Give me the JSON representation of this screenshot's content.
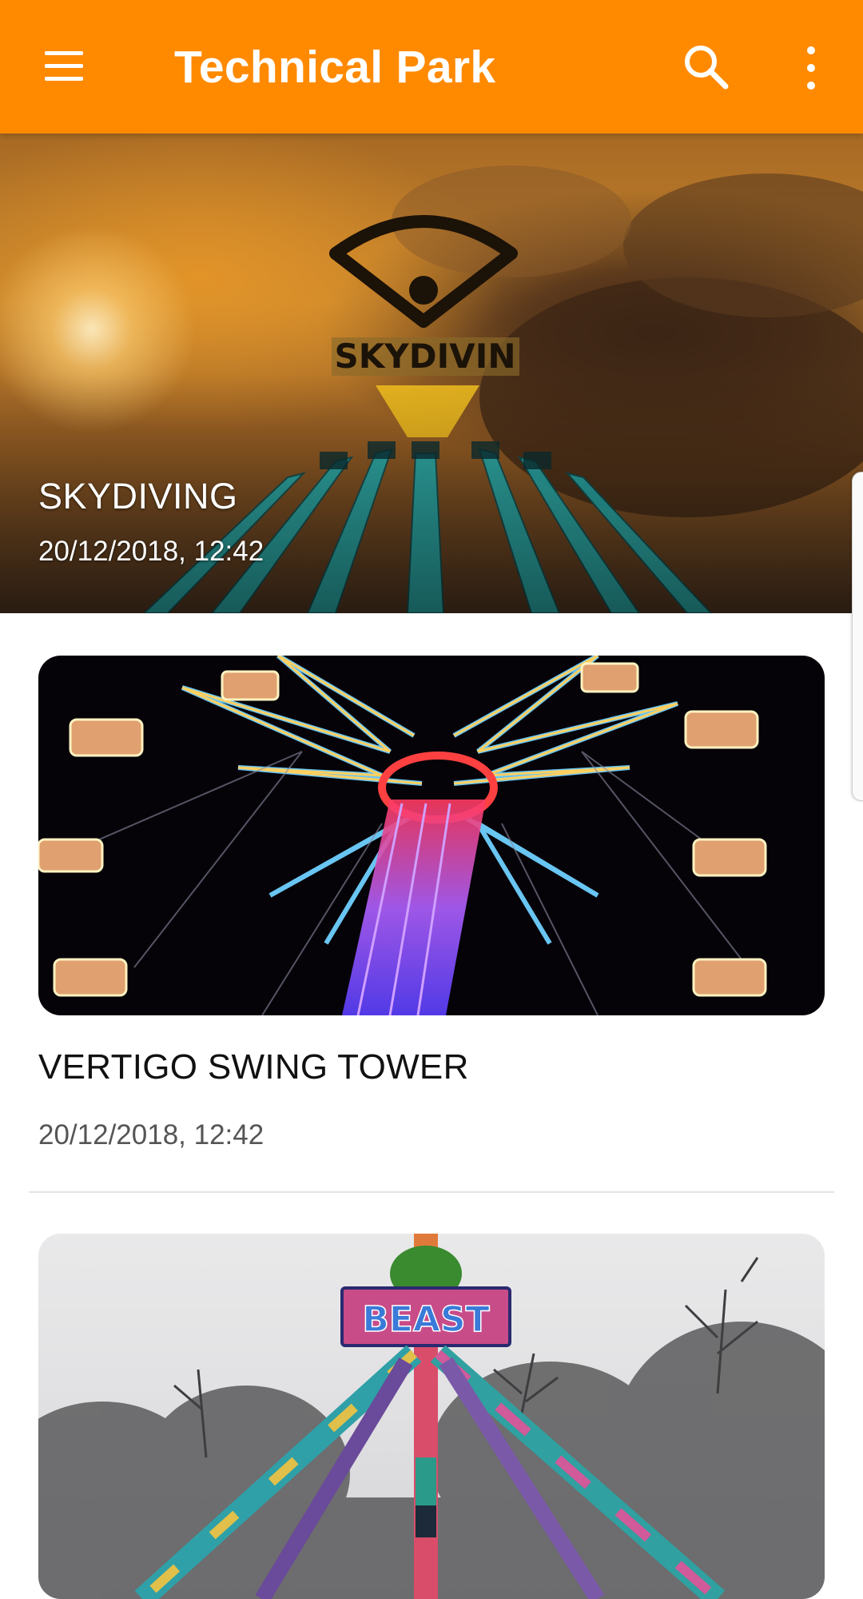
{
  "appbar": {
    "title": "Technical Park",
    "background": "#ff8a00",
    "icons": [
      "menu-icon",
      "search-icon",
      "more-vert-icon"
    ]
  },
  "articles": [
    {
      "title": "SKYDIVING",
      "date": "20/12/2018, 12:42",
      "image_sign_text": "SKYDIVIN"
    },
    {
      "title": "VERTIGO SWING TOWER",
      "date": "20/12/2018, 12:42"
    },
    {
      "image_sign_text": "BEAST"
    }
  ]
}
